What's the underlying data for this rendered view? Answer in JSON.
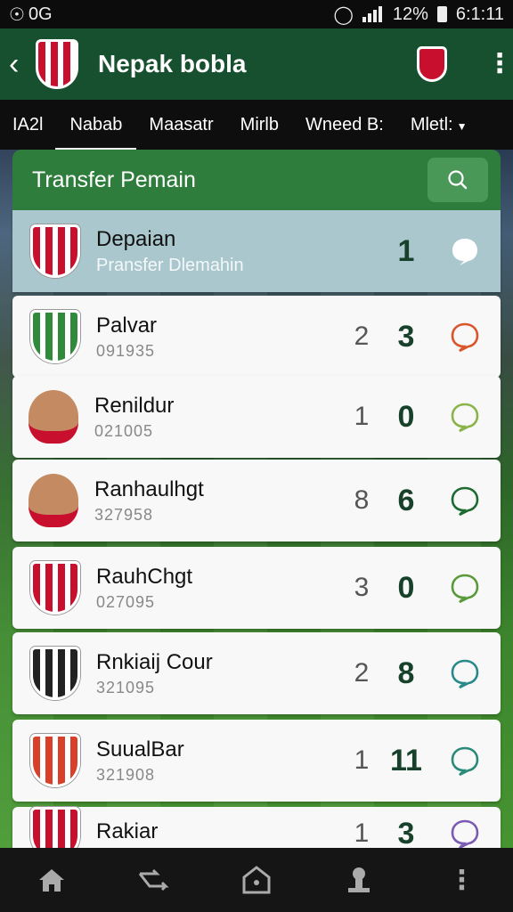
{
  "status_bar": {
    "left_text": "0G",
    "battery": "12%",
    "time": "6:1:11"
  },
  "app_bar": {
    "title": "Nepak bobla"
  },
  "tabs": [
    {
      "label": "IA2l"
    },
    {
      "label": "Nabab"
    },
    {
      "label": "Maasatr"
    },
    {
      "label": "Mirlb"
    },
    {
      "label": "Wneed B:"
    },
    {
      "label": "Mletl:"
    }
  ],
  "search": {
    "label": "Transfer Pemain"
  },
  "rows": [
    {
      "name": "Depaian",
      "sub": "Pransfer Dlemahin",
      "n1": "",
      "n2": "1",
      "logo_color": "#c8102e",
      "bubble_color": "#ffffff"
    },
    {
      "name": "Palvar",
      "sub": "091935",
      "n1": "2",
      "n2": "3",
      "logo_color": "#2f8a3a",
      "bubble_color": "#d9552b"
    },
    {
      "name": "Renildur",
      "sub": "021005",
      "n1": "1",
      "n2": "0",
      "logo_color": "#1e3a8a",
      "bubble_color": "#8ab34a"
    },
    {
      "name": "Ranhaulhgt",
      "sub": "327958",
      "n1": "8",
      "n2": "6",
      "logo_color": "#c48a62",
      "bubble_color": "#1f6a32"
    },
    {
      "name": "RauhChgt",
      "sub": "027095",
      "n1": "3",
      "n2": "0",
      "logo_color": "#c8102e",
      "bubble_color": "#5a9a3a"
    },
    {
      "name": "Rnkiaij Cour",
      "sub": "321095",
      "n1": "2",
      "n2": "8",
      "logo_color": "#222222",
      "bubble_color": "#2a8a8a"
    },
    {
      "name": "SuualBar",
      "sub": "321908",
      "n1": "1",
      "n2": "11",
      "logo_color": "#d8402a",
      "bubble_color": "#2a8a7a"
    },
    {
      "name": "Rakiar",
      "sub": "",
      "n1": "1",
      "n2": "3",
      "logo_color": "#c8102e",
      "bubble_color": "#7a5ab3"
    }
  ]
}
